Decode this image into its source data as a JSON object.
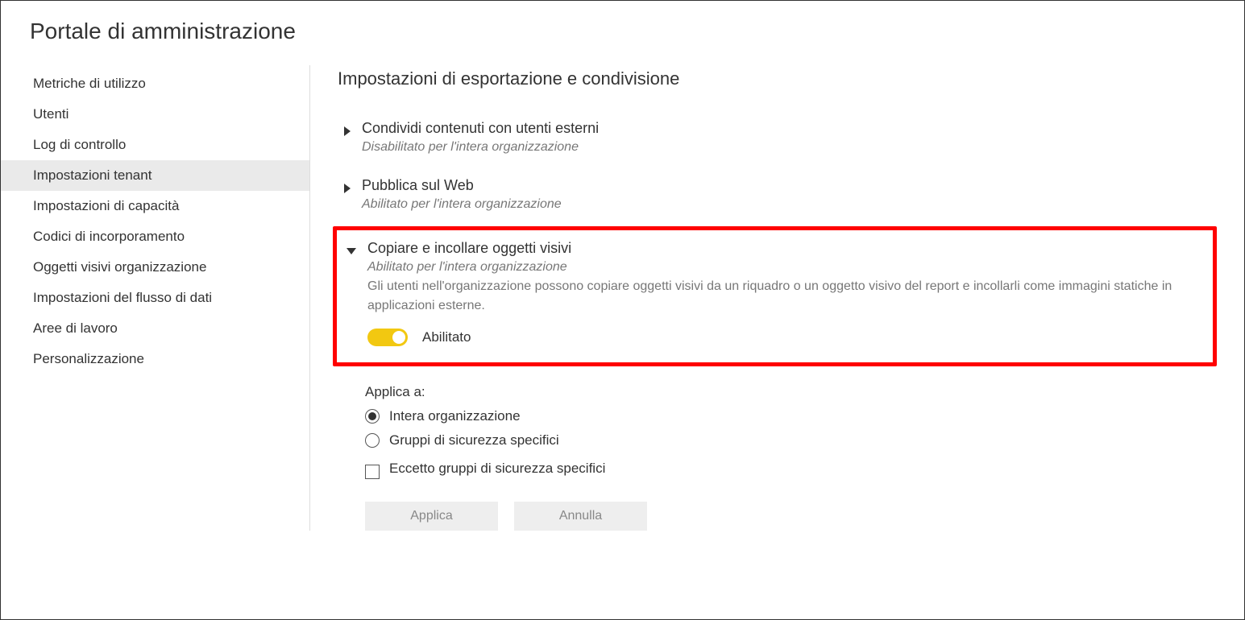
{
  "pageTitle": "Portale di amministrazione",
  "sidebar": {
    "items": [
      {
        "label": "Metriche di utilizzo",
        "selected": false
      },
      {
        "label": "Utenti",
        "selected": false
      },
      {
        "label": "Log di controllo",
        "selected": false
      },
      {
        "label": "Impostazioni tenant",
        "selected": true
      },
      {
        "label": "Impostazioni di capacità",
        "selected": false
      },
      {
        "label": "Codici di incorporamento",
        "selected": false
      },
      {
        "label": "Oggetti visivi organizzazione",
        "selected": false
      },
      {
        "label": "Impostazioni del flusso di dati",
        "selected": false
      },
      {
        "label": "Aree di lavoro",
        "selected": false
      },
      {
        "label": "Personalizzazione",
        "selected": false
      }
    ]
  },
  "main": {
    "sectionTitle": "Impostazioni di esportazione e condivisione",
    "settings": [
      {
        "title": "Condividi contenuti con utenti esterni",
        "status": "Disabilitato per l'intera organizzazione",
        "expanded": false
      },
      {
        "title": "Pubblica sul Web",
        "status": "Abilitato per l'intera organizzazione",
        "expanded": false
      },
      {
        "title": "Copiare e incollare oggetti visivi",
        "status": "Abilitato per l'intera organizzazione",
        "description": "Gli utenti nell'organizzazione possono copiare oggetti visivi da un riquadro o un oggetto visivo del report e incollarli come immagini statiche in applicazioni esterne.",
        "toggleLabel": "Abilitato",
        "toggleOn": true,
        "expanded": true,
        "highlighted": true
      }
    ],
    "applyTo": {
      "label": "Applica a:",
      "options": [
        {
          "label": "Intera organizzazione",
          "selected": true
        },
        {
          "label": "Gruppi di sicurezza specifici",
          "selected": false
        }
      ],
      "checkbox": {
        "label": "Eccetto gruppi di sicurezza specifici",
        "checked": false
      }
    },
    "buttons": {
      "apply": "Applica",
      "cancel": "Annulla"
    }
  }
}
